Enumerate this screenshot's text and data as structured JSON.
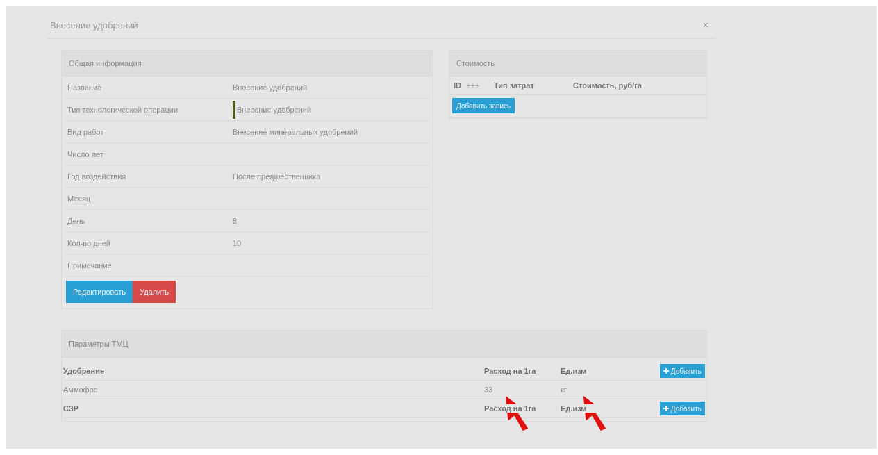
{
  "dialog": {
    "title": "Внесение удобрений",
    "close": "×"
  },
  "info_panel": {
    "title": "Общая информация",
    "rows": [
      {
        "label": "Название",
        "value": "Внесение удобрений",
        "marked": false
      },
      {
        "label": "Тип технологической операции",
        "value": "Внесение удобрений",
        "marked": true
      },
      {
        "label": "Вид работ",
        "value": "Внесение минеральных удобрений",
        "marked": false
      },
      {
        "label": "Число лет",
        "marked": false
      },
      {
        "label": "Год воздействия",
        "value": "После предшественника",
        "marked": false
      },
      {
        "label": "Месяц",
        "marked": false
      },
      {
        "label": "День",
        "value": "8",
        "marked": false
      },
      {
        "label": "Кол-во дней",
        "value": "10",
        "marked": false
      },
      {
        "label": "Примечание",
        "marked": false
      }
    ],
    "buttons": [
      {
        "label": "Редактировать",
        "kind": "primary"
      },
      {
        "label": "Удалить",
        "kind": "danger"
      }
    ]
  },
  "cost_panel": {
    "title": "Стоимость",
    "columns": [
      "ID",
      "+++",
      "Тип затрат",
      "Стоимость, руб/га"
    ],
    "button": "Добавить запись"
  },
  "tmc_panel": {
    "title": "Параметры ТМЦ",
    "groups": [
      {
        "name": "Удобрение",
        "columns": [
          "Расход на 1га",
          "Ед.изм"
        ],
        "button": "Добавить",
        "rows": [
          {
            "name": "Аммофос",
            "rate": "33",
            "unit": "кг"
          }
        ]
      },
      {
        "name": "СЗР",
        "columns": [
          "Расход на 1га",
          "Ед.изм"
        ],
        "button": "Добавить"
      }
    ]
  },
  "annotations": [
    {
      "kind": "arrow"
    },
    {
      "kind": "arrow"
    }
  ]
}
